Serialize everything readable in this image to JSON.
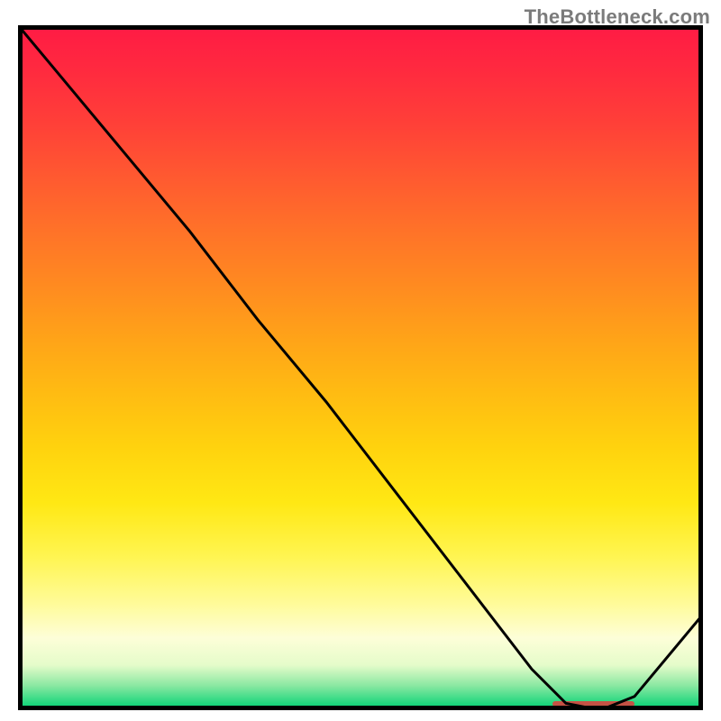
{
  "watermark": "TheBottleneck.com",
  "chart_data": {
    "type": "line",
    "title": "",
    "xlabel": "",
    "ylabel": "",
    "xlim": [
      0,
      100
    ],
    "ylim": [
      0,
      100
    ],
    "grid": false,
    "x": [
      0,
      5,
      15,
      25,
      35,
      45,
      55,
      65,
      75,
      80,
      85,
      90,
      100
    ],
    "y": [
      100,
      94,
      82,
      70,
      57,
      45,
      32,
      19,
      6,
      1,
      0,
      2,
      14
    ],
    "background_gradient": {
      "stops": [
        {
          "pct": 0,
          "color": "#ff1c44"
        },
        {
          "pct": 15,
          "color": "#ff4a34"
        },
        {
          "pct": 35,
          "color": "#ff8a20"
        },
        {
          "pct": 55,
          "color": "#ffc210"
        },
        {
          "pct": 75,
          "color": "#fff23e"
        },
        {
          "pct": 88,
          "color": "#fdfed0"
        },
        {
          "pct": 100,
          "color": "#13d57a"
        }
      ]
    },
    "optimal_zone": {
      "x_start": 78,
      "x_end": 90,
      "color": "#e23b3b"
    },
    "line_color": "#000000",
    "line_width": 3
  }
}
